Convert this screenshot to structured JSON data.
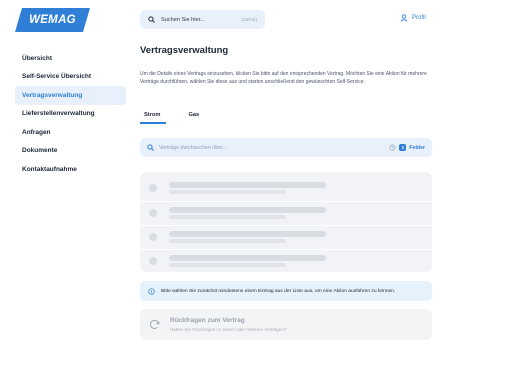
{
  "brand": {
    "logo_text": "WEMAG",
    "accent": "#2f7fd6"
  },
  "header": {
    "search_placeholder": "Suchen Sie hier...",
    "search_shortcut": "(Ctrl+K)",
    "profile_label": "Profil"
  },
  "sidebar": {
    "items": [
      {
        "label": "Übersicht",
        "active": false
      },
      {
        "label": "Self-Service Übersicht",
        "active": false
      },
      {
        "label": "Vertragsverwaltung",
        "active": true
      },
      {
        "label": "Lieferstellenverwaltung",
        "active": false
      },
      {
        "label": "Anfragen",
        "active": false
      },
      {
        "label": "Dokumente",
        "active": false
      },
      {
        "label": "Kontaktaufnahme",
        "active": false
      }
    ]
  },
  "main": {
    "title": "Vertragsverwaltung",
    "description": "Um die Details eines Vertrags einzusehen, klicken Sie bitte auf den entsprechenden Vertrag. Möchten Sie eine Aktion für mehrere Verträge durchführen, wählen Sie diese aus und starten anschließend den gewünschten Self-Service.",
    "tabs": [
      {
        "label": "Strom",
        "active": true
      },
      {
        "label": "Gas",
        "active": false
      }
    ],
    "filter": {
      "placeholder": "Verträge durchsuchen über...",
      "count": "1",
      "fields_label": "Felder"
    },
    "info_text": "Bitte wählen Sie zunächst mindestens einen Eintrag aus der Liste aus, um eine Aktion ausführen zu können.",
    "action": {
      "title": "Rückfragen zum Vertrag",
      "subtitle": "Haben Sie Rückfragen zu einem oder mehrere Verträgen?"
    }
  }
}
